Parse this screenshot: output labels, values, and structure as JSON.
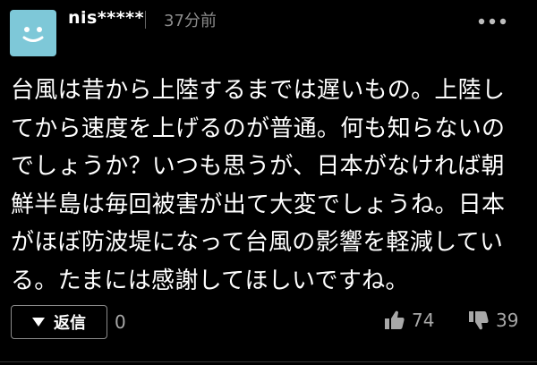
{
  "author": {
    "name": "nis*****",
    "posted_time": "37分前",
    "avatar_color": "#7ec8d8"
  },
  "comment": {
    "lines": [
      "台風は昔から上陸するまでは遅いもの。上陸し",
      "てから速度を上げるのが普通。何も知らないの",
      "でしょうか？いつも思うが、日本がなければ朝",
      "鮮半島は毎回被害が出て大変でしょうね。日本",
      "がほぼ防波堤になって台風の影響を軽減してい",
      "る。たまには感謝してほしいですね。"
    ]
  },
  "actions": {
    "reply_label": "返信",
    "reply_count": "0",
    "like_count": "74",
    "dislike_count": "39"
  },
  "icons": {
    "more": "more-dots-icon",
    "reply": "caret-down-icon",
    "like": "thumbs-up-icon",
    "dislike": "thumbs-down-icon",
    "avatar": "smiley-face-icon"
  }
}
